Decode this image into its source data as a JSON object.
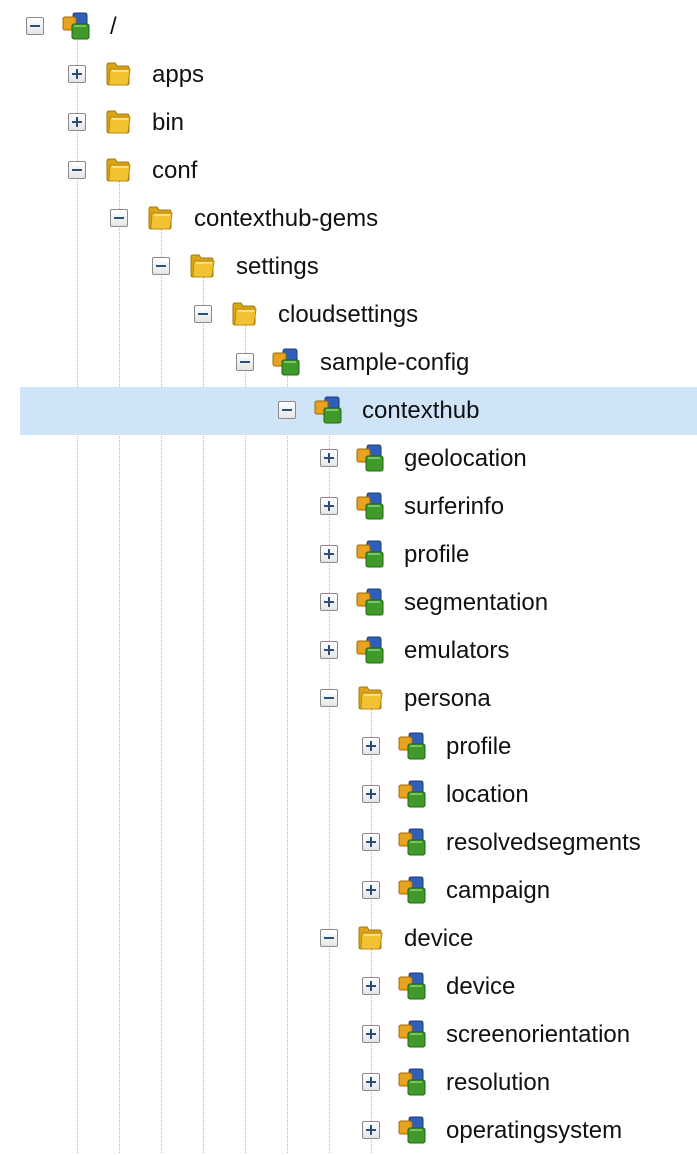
{
  "tree": {
    "nodes": [
      {
        "label": "/",
        "depth": 0,
        "expanded": true,
        "icon": "node-icon"
      },
      {
        "label": "apps",
        "depth": 1,
        "expanded": false,
        "icon": "folder-icon"
      },
      {
        "label": "bin",
        "depth": 1,
        "expanded": false,
        "icon": "folder-icon"
      },
      {
        "label": "conf",
        "depth": 1,
        "expanded": true,
        "icon": "folder-icon"
      },
      {
        "label": "contexthub-gems",
        "depth": 2,
        "expanded": true,
        "icon": "folder-icon"
      },
      {
        "label": "settings",
        "depth": 3,
        "expanded": true,
        "icon": "folder-icon"
      },
      {
        "label": "cloudsettings",
        "depth": 4,
        "expanded": true,
        "icon": "folder-icon"
      },
      {
        "label": "sample-config",
        "depth": 5,
        "expanded": true,
        "icon": "node-icon"
      },
      {
        "label": "contexthub",
        "depth": 6,
        "expanded": true,
        "icon": "node-icon",
        "selected": true
      },
      {
        "label": "geolocation",
        "depth": 7,
        "expanded": false,
        "icon": "node-icon"
      },
      {
        "label": "surferinfo",
        "depth": 7,
        "expanded": false,
        "icon": "node-icon"
      },
      {
        "label": "profile",
        "depth": 7,
        "expanded": false,
        "icon": "node-icon"
      },
      {
        "label": "segmentation",
        "depth": 7,
        "expanded": false,
        "icon": "node-icon"
      },
      {
        "label": "emulators",
        "depth": 7,
        "expanded": false,
        "icon": "node-icon"
      },
      {
        "label": "persona",
        "depth": 7,
        "expanded": true,
        "icon": "folder-icon"
      },
      {
        "label": "profile",
        "depth": 8,
        "expanded": false,
        "icon": "node-icon"
      },
      {
        "label": "location",
        "depth": 8,
        "expanded": false,
        "icon": "node-icon"
      },
      {
        "label": "resolvedsegments",
        "depth": 8,
        "expanded": false,
        "icon": "node-icon"
      },
      {
        "label": "campaign",
        "depth": 8,
        "expanded": false,
        "icon": "node-icon"
      },
      {
        "label": "device",
        "depth": 7,
        "expanded": true,
        "icon": "folder-icon"
      },
      {
        "label": "device",
        "depth": 8,
        "expanded": false,
        "icon": "node-icon"
      },
      {
        "label": "screenorientation",
        "depth": 8,
        "expanded": false,
        "icon": "node-icon"
      },
      {
        "label": "resolution",
        "depth": 8,
        "expanded": false,
        "icon": "node-icon"
      },
      {
        "label": "operatingsystem",
        "depth": 8,
        "expanded": false,
        "icon": "node-icon"
      }
    ]
  },
  "colors": {
    "selection": "#cfe4f7",
    "folder": "#f2c232",
    "node_blue": "#2f5fb8",
    "node_green": "#3f9a2a",
    "node_orange": "#e8a21e"
  }
}
